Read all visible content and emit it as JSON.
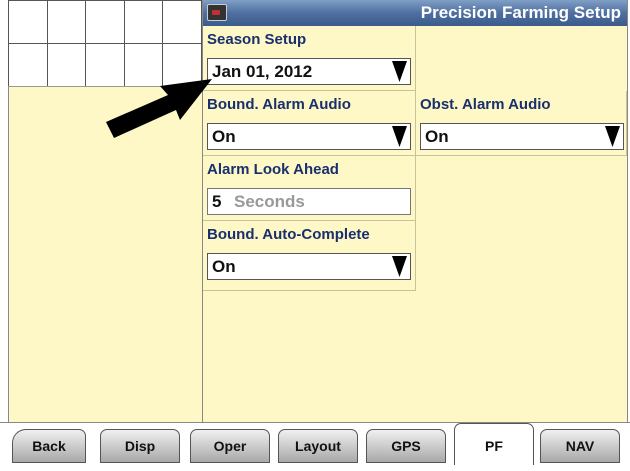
{
  "header": {
    "title": "Precision Farming Setup",
    "icon": "terminal-icon"
  },
  "season_setup": {
    "label": "Season Setup",
    "value": "Jan 01, 2012"
  },
  "boundary_alarm_audio": {
    "label": "Bound. Alarm Audio",
    "value": "On"
  },
  "obstacle_alarm_audio": {
    "label": "Obst. Alarm Audio",
    "value": "On"
  },
  "alarm_look_ahead": {
    "label": "Alarm Look Ahead",
    "value": "5",
    "unit": "Seconds"
  },
  "boundary_auto_complete": {
    "label": "Bound. Auto-Complete",
    "value": "On"
  },
  "tabs": [
    {
      "label": "Back"
    },
    {
      "label": "Disp"
    },
    {
      "label": "Oper"
    },
    {
      "label": "Layout"
    },
    {
      "label": "GPS"
    },
    {
      "label": "PF",
      "active": true
    },
    {
      "label": "NAV"
    }
  ],
  "colors": {
    "background": "#fdf8c6",
    "label_text": "#1a2f6e",
    "titlebar": "#4f6fa0"
  }
}
